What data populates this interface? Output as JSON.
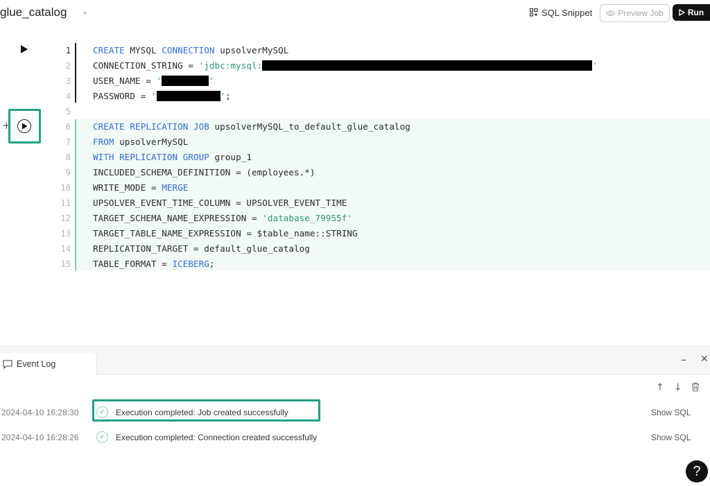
{
  "header": {
    "title": "glue_catalog",
    "snippet_label": "SQL Snippet",
    "preview_label": "Preview Job",
    "run_label": "Run"
  },
  "editor": {
    "line_numbers": [
      "1",
      "2",
      "3",
      "4",
      "5",
      "6",
      "7",
      "8",
      "9",
      "10",
      "11",
      "12",
      "13",
      "14",
      "15"
    ],
    "lines": [
      {
        "kw1": "CREATE",
        "t1": " MYSQL ",
        "kw2": "CONNECTION",
        "t2": " upsolverMySQL"
      },
      {
        "t1": "CONNECTION_STRING = ",
        "s1": "'jdbc:mysql:",
        "s2": "'"
      },
      {
        "t1": "USER_NAME = ",
        "s1": "'",
        "s2": "'"
      },
      {
        "t1": "PASSWORD = ",
        "s1": "'",
        "s2": "'",
        "t2": ";"
      },
      {},
      {
        "kw1": "CREATE REPLICATION JOB",
        "t1": " upsolverMySQL_to_default_glue_catalog"
      },
      {
        "kw1": "FROM",
        "t1": " upsolverMySQL"
      },
      {
        "kw1": "WITH REPLICATION GROUP",
        "t1": " group_1"
      },
      {
        "t1": "INCLUDED_SCHEMA_DEFINITION = (employees.*)"
      },
      {
        "t1": "WRITE_MODE = ",
        "kw1": "MERGE"
      },
      {
        "t1": "UPSOLVER_EVENT_TIME_COLUMN = UPSOLVER_EVENT_TIME"
      },
      {
        "t1": "TARGET_SCHEMA_NAME_EXPRESSION = ",
        "s1": "'database_79955f'"
      },
      {
        "t1": "TARGET_TABLE_NAME_EXPRESSION = $table_name::STRING"
      },
      {
        "t1": "REPLICATION_TARGET = default_glue_catalog"
      },
      {
        "t1": "TABLE_FORMAT = ",
        "kw1": "ICEBERG",
        "t2": ";"
      }
    ]
  },
  "event_log": {
    "tab_label": "Event Log",
    "entries": [
      {
        "time": "2024-04-10 16:28:30",
        "message": "Execution completed: Job created successfully",
        "action": "Show SQL"
      },
      {
        "time": "2024-04-10 16:28:26",
        "message": "Execution completed: Connection created successfully",
        "action": "Show SQL"
      }
    ]
  },
  "help_label": "?",
  "colors": {
    "keyword": "#2f6fd8",
    "string": "#2c9a6f",
    "highlight": "#21a184",
    "success": "#4fbf88"
  },
  "icons": [
    "chevron-down-icon",
    "grid-icon",
    "eye-icon",
    "play-icon",
    "plus-icon",
    "comment-icon",
    "minimize-icon",
    "close-icon",
    "arrow-up-icon",
    "arrow-down-icon",
    "trash-icon",
    "check-circle-icon",
    "help-icon"
  ]
}
